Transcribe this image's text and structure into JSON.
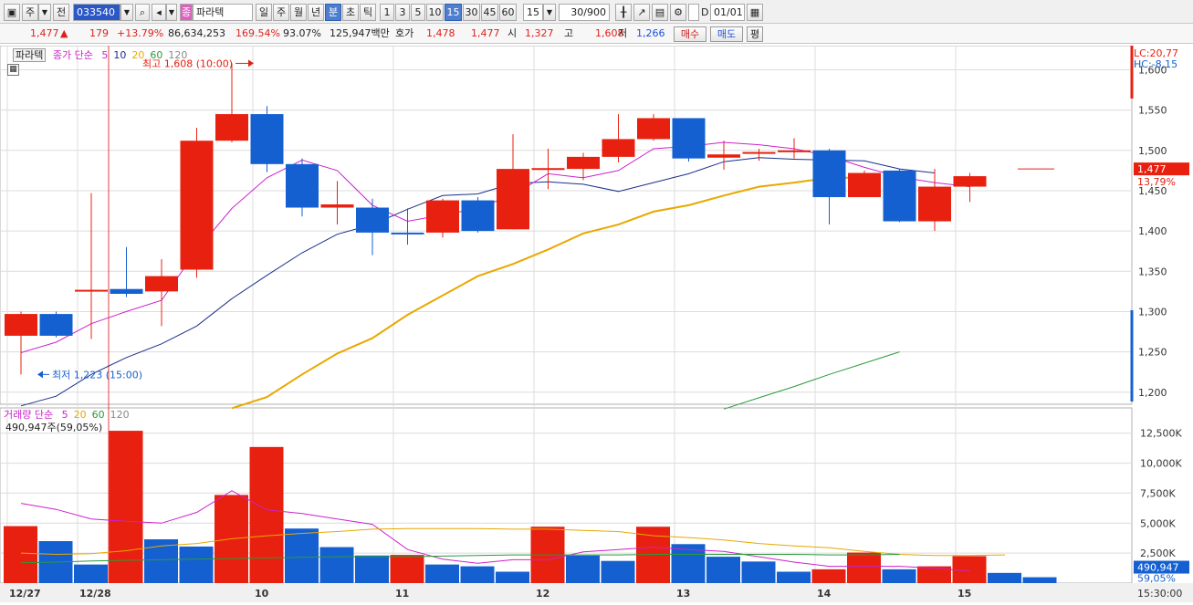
{
  "toolbar": {
    "type_label": "주",
    "prev_label": "전",
    "code": "033540",
    "name": "파라텍",
    "periods": [
      "일",
      "주",
      "월",
      "년",
      "분",
      "초",
      "틱"
    ],
    "active_period": "분",
    "intervals": [
      "1",
      "3",
      "5",
      "10",
      "15",
      "30",
      "45",
      "60"
    ],
    "active_interval": "15",
    "interval_value": "15",
    "count": "30/900",
    "date": "01/01",
    "d_label": "D",
    "sound_badge": "종"
  },
  "quote": {
    "price": "1,477",
    "up_mark": "▲",
    "change": "179",
    "change_rate": "+13.79%",
    "volume": "86,634,253",
    "volume_rate": "169.54%",
    "turnover_rate": "93.07%",
    "amount": "125,947백만",
    "bid_label": "호가",
    "bid1": "1,478",
    "bid2": "1,477",
    "open_label": "시",
    "open": "1,327",
    "high_label": "고",
    "high": "1,608",
    "low_label": "저",
    "low": "1,266",
    "buy_label": "매수",
    "sell_label": "매도",
    "eval_label": "평"
  },
  "price_panel": {
    "stock_tag": "파라텍",
    "legend_title": "종가 단순",
    "ma_labels": [
      "5",
      "10",
      "20",
      "60",
      "120"
    ],
    "ma_colors": [
      "#cc22cc",
      "#1a2f8a",
      "#e8a800",
      "#2a9a3a",
      "#888888"
    ],
    "lc_label": "LC:20,77",
    "hc_label": "HC:-8,15",
    "max_annotation": "최고 1,608 (10:00)",
    "min_annotation": "최저 1,223 (15:00)",
    "current_price_tag": "1,477",
    "current_rate_tag": "13,79%",
    "y_ticks": [
      "1,600",
      "1,550",
      "1,500",
      "1,450",
      "1,400",
      "1,350",
      "1,300",
      "1,250",
      "1,200"
    ]
  },
  "volume_panel": {
    "legend_title": "거래량 단순",
    "ma_labels": [
      "5",
      "20",
      "60",
      "120"
    ],
    "ma_colors": [
      "#cc22cc",
      "#e8a800",
      "#2a9a3a",
      "#888888"
    ],
    "current_volume": "490,947주(59,05%)",
    "volume_tag": "490,947",
    "volume_rate_tag": "59,05%",
    "y_ticks": [
      "12,500K",
      "10,000K",
      "7,500K",
      "5,000K",
      "2,500K"
    ]
  },
  "x_axis": {
    "labels": [
      "12/27",
      "12/28",
      "10",
      "11",
      "12",
      "13",
      "14",
      "15"
    ],
    "time_label": "15:30:00"
  },
  "colors": {
    "up": "#e8200f",
    "down": "#1560d0",
    "grid": "#dcdcdc",
    "current_line": "#e02020"
  },
  "chart_data": {
    "type": "candlestick",
    "price_ylim": [
      1185,
      1630
    ],
    "volume_ylim": [
      0,
      14000
    ],
    "candles": [
      {
        "o": 1270,
        "h": 1300,
        "l": 1222,
        "c": 1297,
        "up": true
      },
      {
        "o": 1297,
        "h": 1300,
        "l": 1268,
        "c": 1270,
        "up": false
      },
      {
        "o": 1327,
        "h": 1447,
        "l": 1266,
        "c": 1327,
        "up": true
      },
      {
        "o": 1328,
        "h": 1380,
        "l": 1318,
        "c": 1322,
        "up": false
      },
      {
        "o": 1325,
        "h": 1365,
        "l": 1282,
        "c": 1344,
        "up": true
      },
      {
        "o": 1352,
        "h": 1528,
        "l": 1342,
        "c": 1512,
        "up": true
      },
      {
        "o": 1512,
        "h": 1608,
        "l": 1510,
        "c": 1545,
        "up": true
      },
      {
        "o": 1545,
        "h": 1555,
        "l": 1473,
        "c": 1483,
        "up": false
      },
      {
        "o": 1483,
        "h": 1490,
        "l": 1418,
        "c": 1429,
        "up": false
      },
      {
        "o": 1429,
        "h": 1462,
        "l": 1408,
        "c": 1433,
        "up": true
      },
      {
        "o": 1429,
        "h": 1440,
        "l": 1370,
        "c": 1398,
        "up": false
      },
      {
        "o": 1398,
        "h": 1428,
        "l": 1383,
        "c": 1398,
        "up": false
      },
      {
        "o": 1398,
        "h": 1440,
        "l": 1392,
        "c": 1438,
        "up": true
      },
      {
        "o": 1438,
        "h": 1442,
        "l": 1398,
        "c": 1400,
        "up": false
      },
      {
        "o": 1402,
        "h": 1520,
        "l": 1402,
        "c": 1477,
        "up": true
      },
      {
        "o": 1476,
        "h": 1502,
        "l": 1452,
        "c": 1478,
        "up": true
      },
      {
        "o": 1477,
        "h": 1497,
        "l": 1463,
        "c": 1492,
        "up": true
      },
      {
        "o": 1492,
        "h": 1545,
        "l": 1485,
        "c": 1514,
        "up": true
      },
      {
        "o": 1514,
        "h": 1545,
        "l": 1512,
        "c": 1540,
        "up": true
      },
      {
        "o": 1540,
        "h": 1540,
        "l": 1486,
        "c": 1490,
        "up": false
      },
      {
        "o": 1491,
        "h": 1512,
        "l": 1476,
        "c": 1495,
        "up": true
      },
      {
        "o": 1497,
        "h": 1502,
        "l": 1487,
        "c": 1498,
        "up": true
      },
      {
        "o": 1498,
        "h": 1515,
        "l": 1490,
        "c": 1500,
        "up": true
      },
      {
        "o": 1500,
        "h": 1502,
        "l": 1408,
        "c": 1442,
        "up": false
      },
      {
        "o": 1442,
        "h": 1475,
        "l": 1442,
        "c": 1472,
        "up": true
      },
      {
        "o": 1475,
        "h": 1477,
        "l": 1411,
        "c": 1412,
        "up": false
      },
      {
        "o": 1412,
        "h": 1477,
        "l": 1400,
        "c": 1455,
        "up": true
      },
      {
        "o": 1455,
        "h": 1472,
        "l": 1436,
        "c": 1468,
        "up": true
      }
    ],
    "volume_values": [
      4750,
      3500,
      1550,
      12700,
      3650,
      3050,
      7350,
      11350,
      4550,
      3000,
      2300,
      2350,
      1550,
      1400,
      950,
      4700,
      2300,
      1850,
      4700,
      3250,
      2200,
      1800,
      950,
      1150,
      2550,
      1150,
      1400,
      2250,
      850,
      491
    ],
    "volume_up": [
      true,
      false,
      false,
      true,
      false,
      false,
      true,
      true,
      false,
      false,
      false,
      true,
      false,
      false,
      false,
      true,
      false,
      false,
      true,
      false,
      false,
      false,
      false,
      true,
      true,
      false,
      true,
      true,
      false,
      false
    ],
    "price_ma5": [
      1249,
      1262,
      1285,
      1300,
      1314,
      1376,
      1428,
      1466,
      1488,
      1475,
      1432,
      1412,
      1420,
      1428,
      1445,
      1471,
      1466,
      1475,
      1502,
      1505,
      1510,
      1507,
      1502,
      1493,
      1479,
      1467,
      1460,
      1455
    ],
    "price_ma10": [
      1183,
      1195,
      1222,
      1243,
      1260,
      1282,
      1316,
      1345,
      1373,
      1396,
      1408,
      1427,
      1444,
      1446,
      1459,
      1461,
      1458,
      1449,
      1460,
      1471,
      1486,
      1491,
      1489,
      1488,
      1487,
      1477,
      1472
    ],
    "price_ma20": [
      1180,
      1194,
      1222,
      1248,
      1267,
      1296,
      1320,
      1344,
      1359,
      1377,
      1397,
      1408,
      1424,
      1432,
      1444,
      1455,
      1460,
      1466,
      1466
    ],
    "price_ma60": [
      1179,
      1193,
      1207,
      1222,
      1236,
      1250
    ],
    "volume_ma5": [
      6650,
      6150,
      5350,
      5150,
      5000,
      5900,
      7700,
      6100,
      5800,
      5350,
      4900,
      2800,
      2000,
      1650,
      1950,
      1950,
      2600,
      2800,
      3000,
      2800,
      2650,
      2200,
      1750,
      1400,
      1400,
      1400,
      1250,
      1000
    ],
    "volume_ma20": [
      2500,
      2400,
      2450,
      2700,
      3100,
      3300,
      3700,
      3950,
      4150,
      4300,
      4500,
      4550,
      4550,
      4550,
      4500,
      4500,
      4400,
      4300,
      3950,
      3800,
      3600,
      3300,
      3100,
      2950,
      2650,
      2400,
      2300,
      2300,
      2350
    ],
    "volume_ma60": [
      1700,
      1750,
      1850,
      1900,
      1950,
      2000,
      2050,
      2100,
      2150,
      2200,
      2200,
      2200,
      2250,
      2300,
      2350,
      2350,
      2350,
      2350,
      2400,
      2400,
      2400,
      2400,
      2400,
      2350,
      2350,
      2400
    ]
  }
}
